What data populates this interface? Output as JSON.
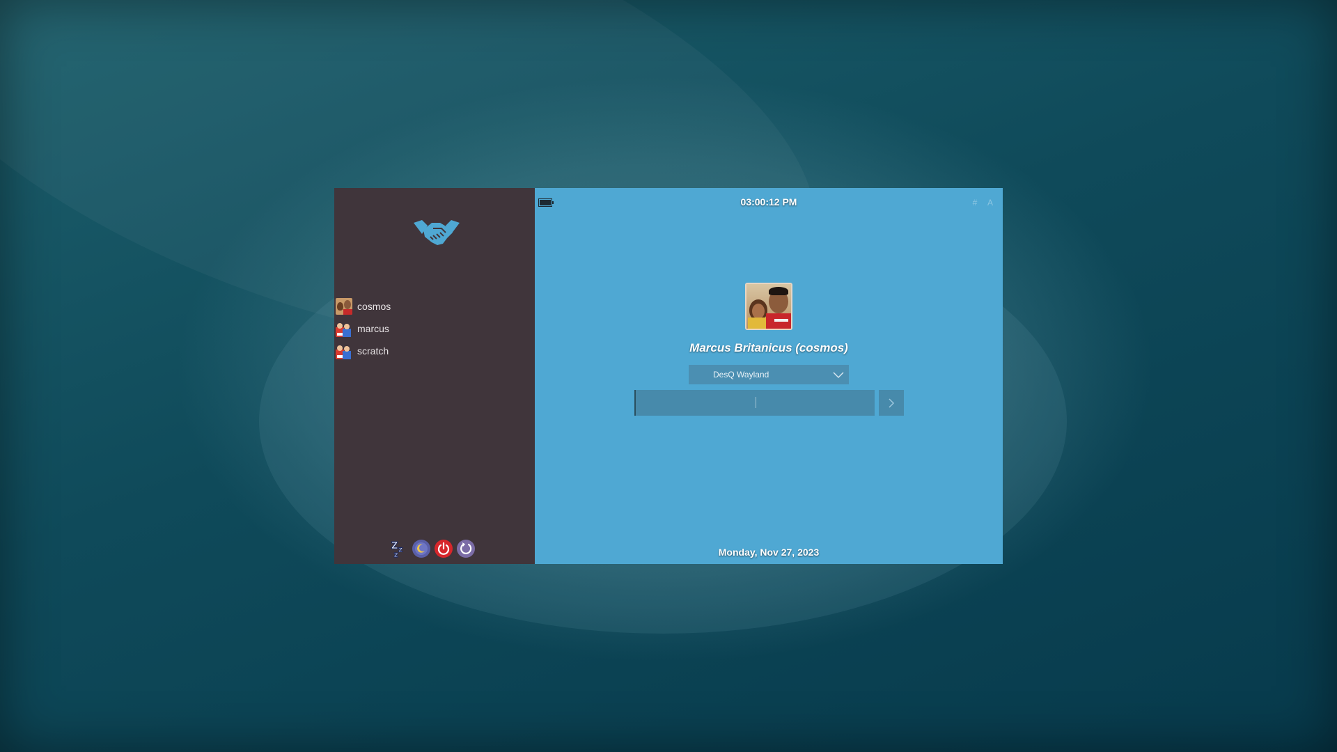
{
  "clock": {
    "time": "03:00:12 PM"
  },
  "date": {
    "text": "Monday, Nov 27, 2023"
  },
  "keyboard_indicators": {
    "text": "# A"
  },
  "users": [
    {
      "name": "cosmos",
      "icon": "user-photo-icon"
    },
    {
      "name": "marcus",
      "icon": "generic-user-icon"
    },
    {
      "name": "scratch",
      "icon": "generic-user-icon"
    }
  ],
  "selected_user": {
    "full_name": "Marcus Britanicus (cosmos)"
  },
  "session": {
    "selected": "DesQ Wayland"
  },
  "password": {
    "value": ""
  },
  "power": {
    "suspend_icon": "sleep-zzz-icon",
    "hibernate_icon": "moon-icon",
    "shutdown_icon": "power-icon",
    "reboot_icon": "reboot-icon"
  },
  "colors": {
    "sidebar_bg": "#40353b",
    "main_bg": "#4fa8d3",
    "field_bg": "#478aab",
    "logo": "#4fa8d3"
  }
}
